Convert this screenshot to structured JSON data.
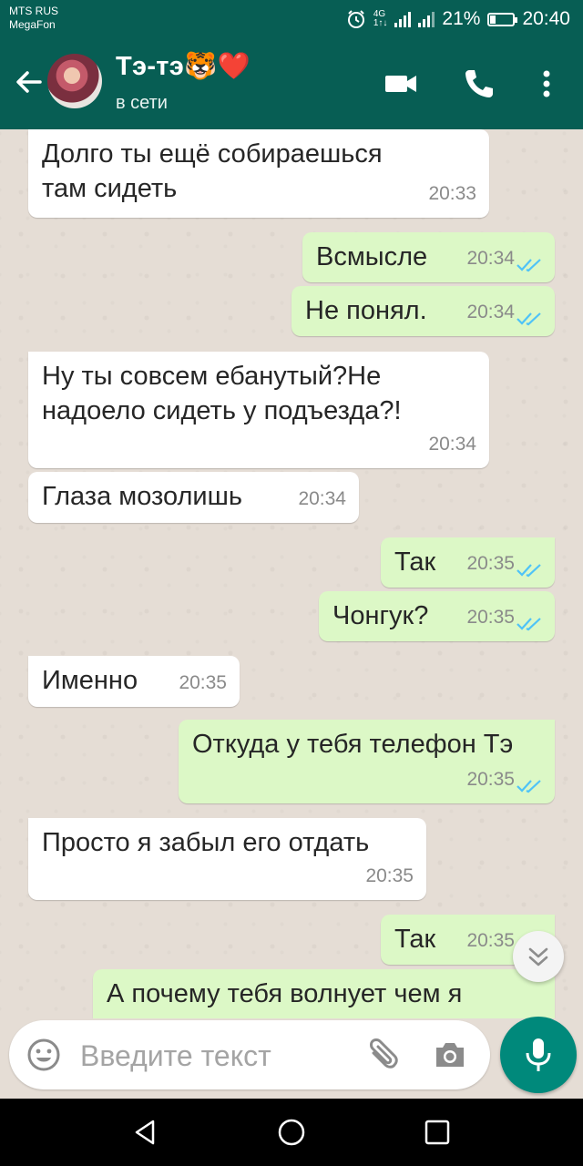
{
  "status_bar": {
    "carrier_1": "MTS RUS",
    "carrier_2": "MegaFon",
    "network_top": "4G",
    "network_bottom": "1↑↓",
    "battery_percent": "21%",
    "time": "20:40"
  },
  "header": {
    "contact_name": "Тэ-тэ🐯❤️",
    "contact_status": "в сети"
  },
  "messages": [
    {
      "direction": "in",
      "text_lines": [
        "Долго ты ещё собираешься",
        "там сидеть"
      ],
      "time": "20:33"
    },
    {
      "direction": "out",
      "text_lines": [
        "Всмысле"
      ],
      "time": "20:34",
      "read": true
    },
    {
      "direction": "out",
      "text_lines": [
        "Не понял."
      ],
      "time": "20:34",
      "read": true
    },
    {
      "direction": "in",
      "text_lines": [
        "Ну ты совсем ебанутый?Не",
        "надоело сидеть у подъезда?!"
      ],
      "time": "20:34"
    },
    {
      "direction": "in",
      "text_lines": [
        "Глаза мозолишь"
      ],
      "time": "20:34"
    },
    {
      "direction": "out",
      "text_lines": [
        "Так"
      ],
      "time": "20:35",
      "read": true
    },
    {
      "direction": "out",
      "text_lines": [
        "Чонгук?"
      ],
      "time": "20:35",
      "read": true
    },
    {
      "direction": "in",
      "text_lines": [
        "Именно"
      ],
      "time": "20:35"
    },
    {
      "direction": "out",
      "text_lines": [
        "Откуда у тебя телефон Тэ"
      ],
      "time": "20:35",
      "read": true
    },
    {
      "direction": "in",
      "text_lines": [
        "Просто я забыл его отдать"
      ],
      "time": "20:35"
    },
    {
      "direction": "out",
      "text_lines": [
        "Так"
      ],
      "time": "20:35"
    },
    {
      "direction": "out",
      "text_lines": [
        "А почему тебя волнует чем я"
      ],
      "time": ""
    }
  ],
  "composer": {
    "placeholder": "Введите текст"
  },
  "icons": {
    "back": "arrow-left-icon",
    "video": "video-camera-icon",
    "call": "phone-icon",
    "menu": "more-vertical-icon",
    "emoji": "emoji-icon",
    "attach": "paperclip-icon",
    "camera": "camera-icon",
    "mic": "microphone-icon",
    "scroll_down": "chevron-double-down-icon",
    "read_receipt": "double-check-icon"
  },
  "colors": {
    "header": "#075e54",
    "outgoing_bubble": "#dcf8c6",
    "incoming_bubble": "#ffffff",
    "tick_read": "#4fc3f7",
    "mic_button": "#00897b"
  }
}
